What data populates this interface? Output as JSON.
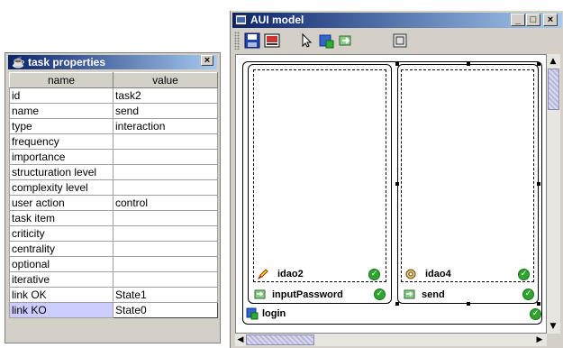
{
  "task_properties": {
    "title": "task properties",
    "headers": [
      "name",
      "value"
    ],
    "rows": [
      {
        "name": "id",
        "value": "task2"
      },
      {
        "name": "name",
        "value": "send"
      },
      {
        "name": "type",
        "value": "interaction"
      },
      {
        "name": "frequency",
        "value": ""
      },
      {
        "name": "importance",
        "value": ""
      },
      {
        "name": "structuration level",
        "value": ""
      },
      {
        "name": "complexity level",
        "value": ""
      },
      {
        "name": "user action",
        "value": "control"
      },
      {
        "name": "task item",
        "value": ""
      },
      {
        "name": "criticity",
        "value": ""
      },
      {
        "name": "centrality",
        "value": ""
      },
      {
        "name": "optional",
        "value": ""
      },
      {
        "name": "iterative",
        "value": ""
      },
      {
        "name": "link OK",
        "value": "State1"
      },
      {
        "name": "link KO",
        "value": "State0"
      }
    ],
    "close_label": "×"
  },
  "aui_model": {
    "title": "AUI model",
    "window_buttons": {
      "minimize": "_",
      "maximize": "□",
      "close": "×"
    },
    "toolbar_icons": [
      "save-icon",
      "image-icon",
      "pointer-icon",
      "add-task-icon",
      "link-icon",
      "frame-icon"
    ],
    "containers": {
      "outer_label": "login",
      "left_label": "inputPassword",
      "right_label": "send",
      "left_inner_label": "idao2",
      "right_inner_label": "idao4"
    }
  },
  "colors": {
    "title_bar_start": "#0a246a",
    "title_bar_end": "#a6caf0",
    "ok_green": "#2fa52f",
    "selected_row": "#ccccff"
  }
}
